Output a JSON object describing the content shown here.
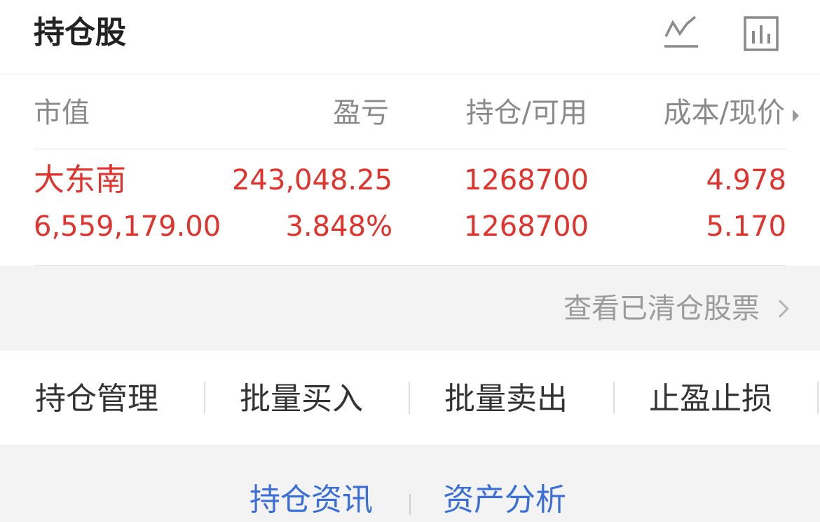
{
  "header": {
    "title": "持仓股",
    "icons": [
      "trend-chart-icon",
      "bar-chart-icon"
    ]
  },
  "columns": {
    "market_value": "市值",
    "profit_loss": "盈亏",
    "position_available": "持仓/可用",
    "cost_price": "成本/现价"
  },
  "holdings": [
    {
      "name": "大东南",
      "market_value": "6,559,179.00",
      "profit_loss": "243,048.25",
      "profit_loss_pct": "3.848%",
      "position": "1268700",
      "available": "1268700",
      "cost": "4.978",
      "price": "5.170"
    }
  ],
  "cleared_link": "查看已清仓股票",
  "actions": [
    "持仓管理",
    "批量买入",
    "批量卖出",
    "止盈止损"
  ],
  "bottom_links": [
    "持仓资讯",
    "资产分析"
  ],
  "colors": {
    "profit_red": "#e2322c",
    "link_blue": "#3a6ed8",
    "muted_gray": "#8a8a8a"
  }
}
